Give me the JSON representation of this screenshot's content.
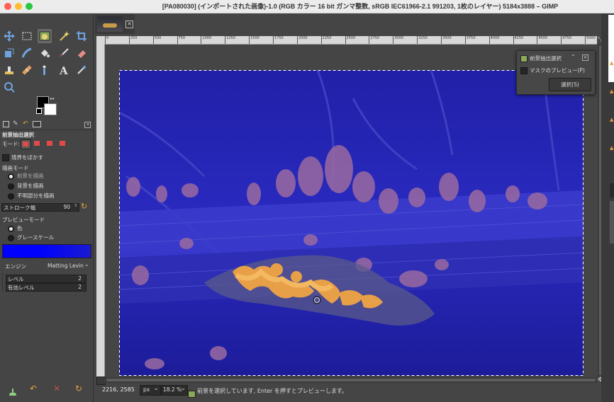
{
  "window": {
    "title": "[PA080030] (インポートされた画像)-1.0 (RGB カラー 16 bit ガンマ整数, sRGB IEC61966-2.1 991203, 1枚のレイヤー) 5184x3888 – GIMP",
    "colors": {
      "close": "#ff5f57",
      "minimize": "#febc2e",
      "zoom": "#28c840"
    }
  },
  "toolbox": {
    "tools": [
      "move-tool",
      "rect-select-tool",
      "foreground-select-tool",
      "fuzzy-select-tool",
      "crop-tool",
      "unified-transform-tool",
      "warp-tool",
      "bucket-fill-tool",
      "paintbrush-tool",
      "eraser-tool",
      "clone-tool",
      "heal-tool",
      "smudge-tool",
      "text-tool",
      "color-picker-tool",
      "zoom-tool"
    ],
    "fg_color": "#000000",
    "bg_color": "#ffffff"
  },
  "tool_options": {
    "title": "前景抽出選択",
    "mode_label": "モード:",
    "feather_label": "境界をぼかす",
    "draw_mode_label": "描画モード",
    "draw_modes": [
      "前景を描画",
      "背景を描画",
      "不明部分を描画"
    ],
    "stroke_width_label": "ストローク幅",
    "stroke_width_value": "90",
    "preview_mode_label": "プレビューモード",
    "preview_modes": [
      "色",
      "グレースケール"
    ],
    "preview_color": "#0000ff",
    "engine_label": "エンジン",
    "engine_value": "Matting Levin",
    "levels_label": "レベル",
    "levels_value": "2",
    "active_levels_label": "有効レベル",
    "active_levels_value": "2"
  },
  "image_tab": {
    "close_icon": "close-icon"
  },
  "ruler": {
    "marks": [
      "0",
      "250",
      "500",
      "750",
      "1000",
      "1250",
      "1500",
      "1750",
      "2000",
      "2250",
      "2500",
      "2750",
      "3000",
      "3250",
      "3500",
      "3750",
      "4000",
      "4250",
      "4500",
      "4750",
      "5000"
    ]
  },
  "fg_dialog": {
    "title": "前景抽出選択",
    "preview_mask_label": "マスクのプレビュー(P)",
    "select_button": "選択(S)"
  },
  "status": {
    "coords": "2216, 2585",
    "unit": "px",
    "zoom": "18.2 %",
    "message": "前景を選択しています, Enter を押すとプレビューします。"
  }
}
